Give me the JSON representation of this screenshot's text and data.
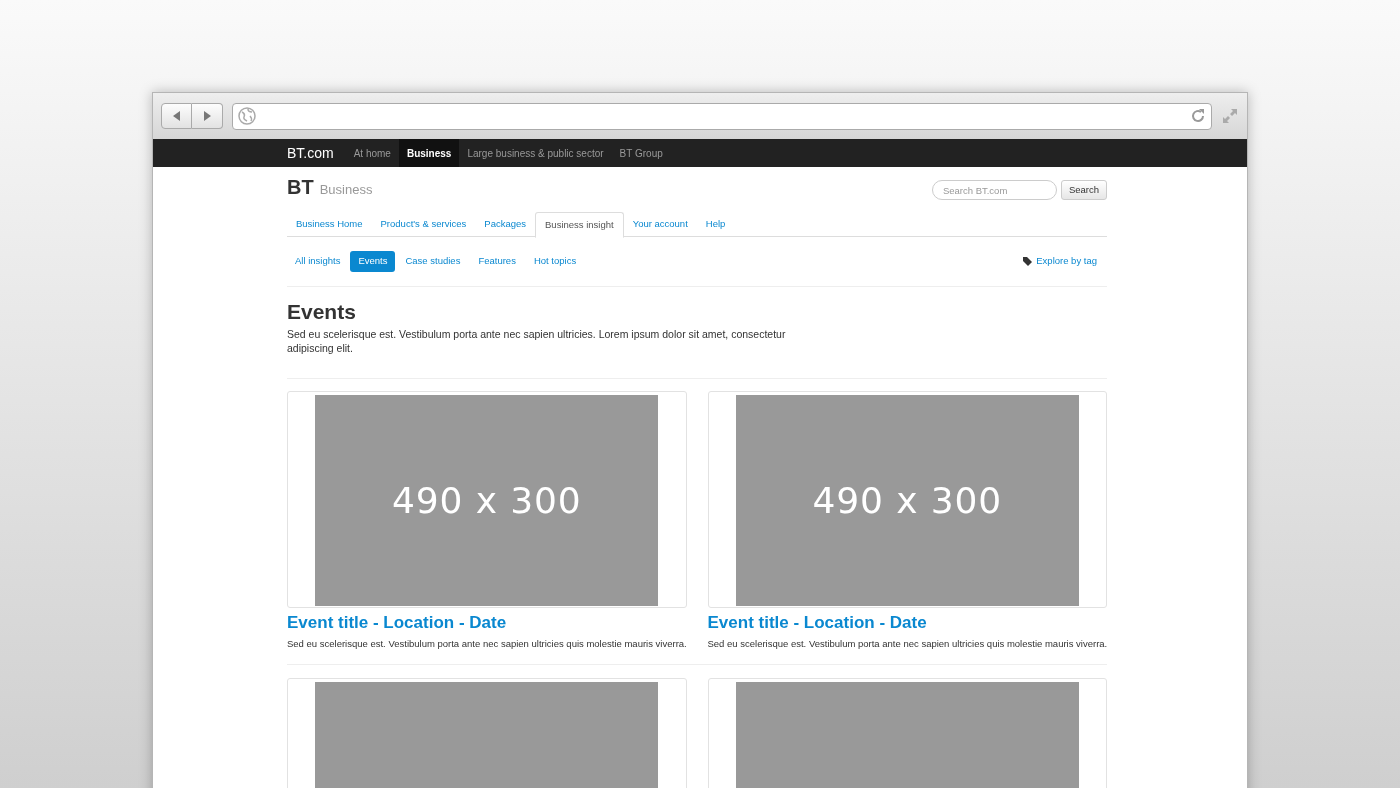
{
  "top_nav": {
    "brand": "BT.com",
    "items": [
      {
        "label": "At home",
        "selected": false
      },
      {
        "label": "Business",
        "selected": true
      },
      {
        "label": "Large business & public sector",
        "selected": false
      },
      {
        "label": "BT Group",
        "selected": false
      }
    ]
  },
  "header": {
    "logo": "BT",
    "subtitle": "Business",
    "search": {
      "placeholder": "Search BT.com",
      "button": "Search"
    }
  },
  "tabs": [
    {
      "label": "Business Home",
      "selected": false
    },
    {
      "label": "Product's & services",
      "selected": false
    },
    {
      "label": "Packages",
      "selected": false
    },
    {
      "label": "Business insight",
      "selected": true
    },
    {
      "label": "Your account",
      "selected": false
    },
    {
      "label": "Help",
      "selected": false
    }
  ],
  "pills": [
    {
      "label": "All insights",
      "selected": false
    },
    {
      "label": "Events",
      "selected": true
    },
    {
      "label": "Case studies",
      "selected": false
    },
    {
      "label": "Features",
      "selected": false
    },
    {
      "label": "Hot topics",
      "selected": false
    }
  ],
  "explore_link": "Explore by tag",
  "page": {
    "title": "Events",
    "intro": "Sed eu scelerisque est. Vestibulum porta ante nec sapien ultricies. Lorem ipsum dolor sit amet, consectetur adipiscing elit."
  },
  "events": [
    {
      "kind": "full",
      "image_label": "490 x 300",
      "title": "Event title - Location - Date",
      "description": "Sed eu scelerisque est. Vestibulum porta ante nec sapien ultricies quis molestie mauris viverra."
    },
    {
      "kind": "full",
      "image_label": "490 x 300",
      "title": "Event title - Location - Date",
      "description": "Sed eu scelerisque est. Vestibulum porta ante nec sapien ultricies quis molestie mauris viverra."
    },
    {
      "kind": "image"
    },
    {
      "kind": "image"
    }
  ]
}
